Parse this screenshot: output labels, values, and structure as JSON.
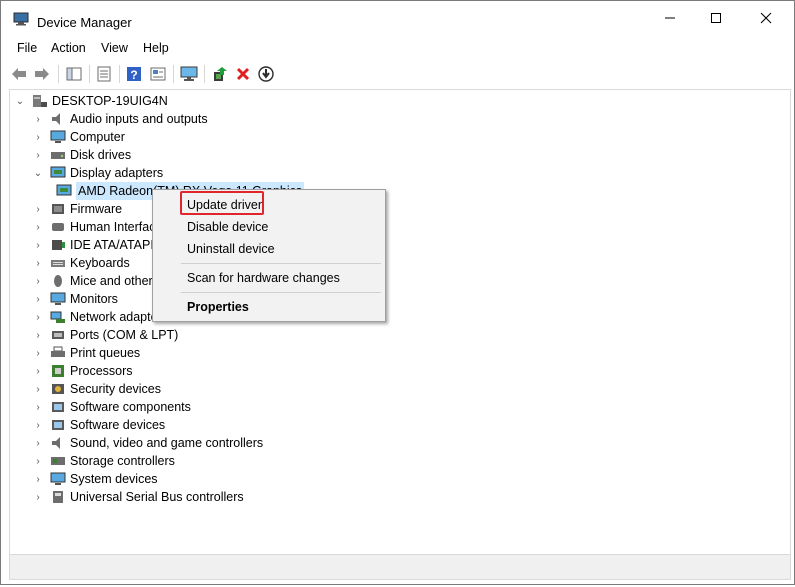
{
  "window": {
    "title": "Device Manager"
  },
  "menu": [
    "File",
    "Action",
    "View",
    "Help"
  ],
  "toolbar": [
    "back-arrow-icon",
    "forward-arrow-icon",
    "show-hide-tree-icon",
    "properties-icon",
    "help-icon",
    "details-view-icon",
    "monitor-icon",
    "update-driver-icon",
    "uninstall-device-icon",
    "download-icon"
  ],
  "tree": {
    "root": "DESKTOP-19UIG4N",
    "categories": [
      "Audio inputs and outputs",
      "Computer",
      "Disk drives",
      "Display adapters",
      "Firmware",
      "Human Interfac",
      "IDE ATA/ATAPI c",
      "Keyboards",
      "Mice and other",
      "Monitors",
      "Network adapte",
      "Ports (COM & LPT)",
      "Print queues",
      "Processors",
      "Security devices",
      "Software components",
      "Software devices",
      "Sound, video and game controllers",
      "Storage controllers",
      "System devices",
      "Universal Serial Bus controllers"
    ],
    "selected_device": "AMD Radeon(TM) RX Vega 11 Graphics"
  },
  "context_menu": {
    "update_driver": "Update driver",
    "disable_device": "Disable device",
    "uninstall_device": "Uninstall device",
    "scan": "Scan for hardware changes",
    "properties": "Properties"
  },
  "colors": {
    "selection": "#cce8ff",
    "highlight_box": "#e0262d",
    "menu_bg": "#f2f2f2"
  }
}
